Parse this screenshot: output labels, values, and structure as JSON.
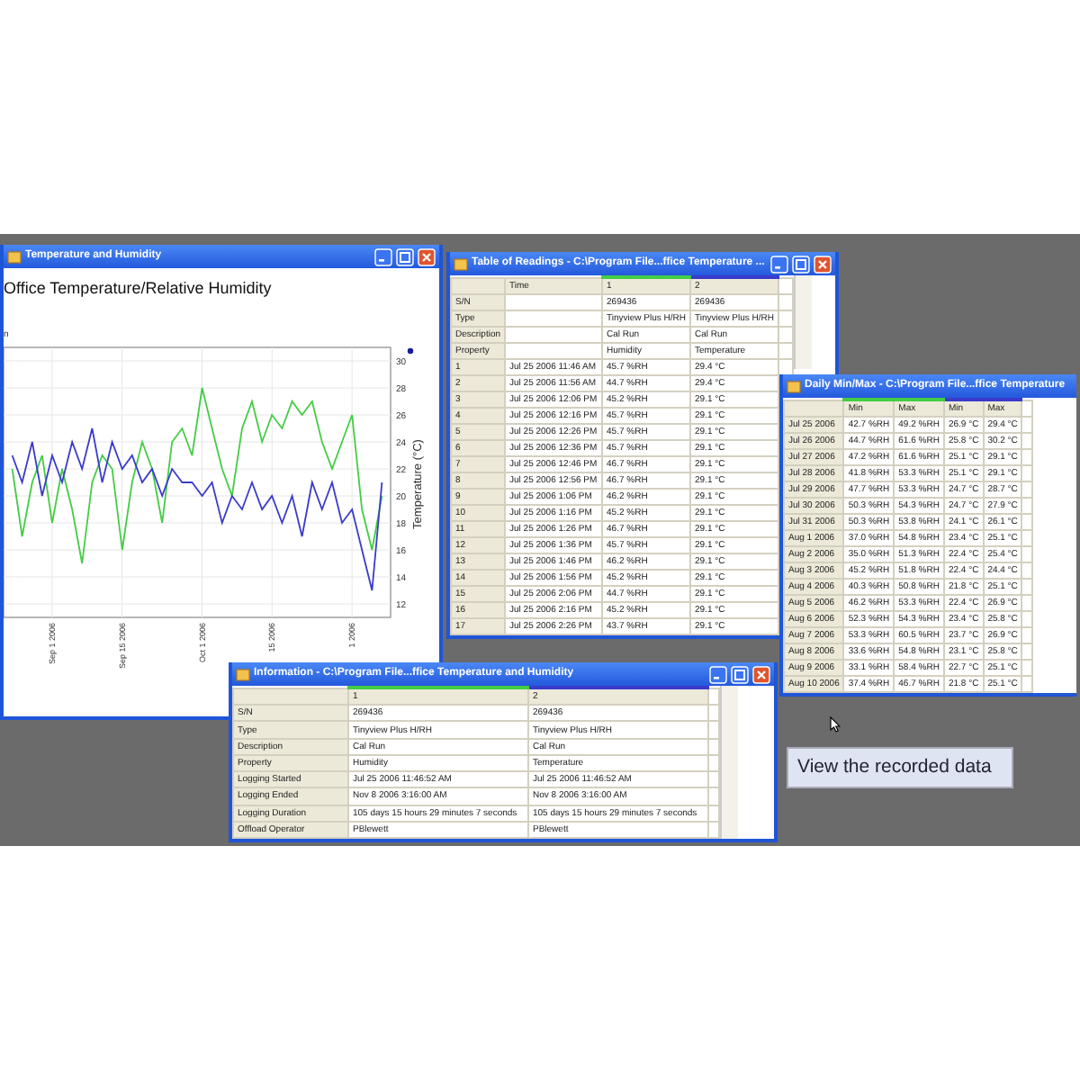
{
  "chart_window": {
    "title": "Temperature and Humidity",
    "legend_fragment": "n",
    "chart_data": {
      "type": "line",
      "title": "Office Temperature/Relative Humidity",
      "ylabel": "Temperature (°C)",
      "categories": [
        null,
        null,
        null,
        null,
        "Sep 1 2006",
        null,
        null,
        null,
        null,
        null,
        null,
        "Sep 15 2006",
        null,
        null,
        null,
        null,
        null,
        null,
        null,
        "Oct 1 2006",
        null,
        null,
        null,
        null,
        null,
        null,
        "15 2006",
        null,
        null,
        null,
        null,
        null,
        null,
        null,
        "1 2006",
        null,
        null,
        null
      ],
      "series": [
        {
          "color": "#44cc44",
          "values": [
            22,
            17,
            21,
            23,
            18,
            22,
            19,
            15,
            21,
            23,
            22,
            16,
            21,
            24,
            22,
            18,
            24,
            25,
            23,
            28,
            25,
            22,
            20,
            25,
            27,
            24,
            26,
            25,
            27,
            26,
            27,
            24,
            22,
            24,
            26,
            19,
            16,
            20
          ]
        },
        {
          "color": "#3a3acc",
          "values": [
            23,
            21,
            24,
            20,
            23,
            21,
            24,
            22,
            25,
            21,
            24,
            22,
            23,
            21,
            22,
            20,
            22,
            21,
            21,
            20,
            21,
            18,
            20,
            19,
            21,
            19,
            20,
            18,
            20,
            17,
            21,
            19,
            21,
            18,
            19,
            16,
            13,
            21
          ]
        }
      ],
      "ylim": [
        11,
        31
      ],
      "grid": true,
      "yticks": [
        30,
        28,
        26,
        24,
        22,
        20,
        18,
        16,
        14,
        12
      ]
    }
  },
  "readings_window": {
    "title": "Table of Readings - C:\\Program File...ffice Temperature ...",
    "columns": [
      {
        "label": "Time"
      },
      {
        "label": "1",
        "color": "#44cc44"
      },
      {
        "label": "2",
        "color": "#3a3acc"
      }
    ],
    "rows": [
      {
        "label": "S/N",
        "values": [
          "269436",
          "269436"
        ]
      },
      {
        "label": "Type",
        "values": [
          "Tinyview Plus H/RH",
          "Tinyview Plus H/RH"
        ]
      },
      {
        "label": "Description",
        "values": [
          "Cal Run",
          "Cal Run"
        ]
      },
      {
        "label": "Property",
        "values": [
          "Humidity",
          "Temperature"
        ]
      },
      {
        "label": "1",
        "time": "Jul 25 2006 11:46 AM",
        "values": [
          "45.7 %RH",
          "29.4 °C"
        ]
      },
      {
        "label": "2",
        "time": "Jul 25 2006 11:56 AM",
        "values": [
          "44.7 %RH",
          "29.4 °C"
        ]
      },
      {
        "label": "3",
        "time": "Jul 25 2006 12:06 PM",
        "values": [
          "45.2 %RH",
          "29.1 °C"
        ]
      },
      {
        "label": "4",
        "time": "Jul 25 2006 12:16 PM",
        "values": [
          "45.7 %RH",
          "29.1 °C"
        ]
      },
      {
        "label": "5",
        "time": "Jul 25 2006 12:26 PM",
        "values": [
          "45.7 %RH",
          "29.1 °C"
        ]
      },
      {
        "label": "6",
        "time": "Jul 25 2006 12:36 PM",
        "values": [
          "45.7 %RH",
          "29.1 °C"
        ]
      },
      {
        "label": "7",
        "time": "Jul 25 2006 12:46 PM",
        "values": [
          "46.7 %RH",
          "29.1 °C"
        ]
      },
      {
        "label": "8",
        "time": "Jul 25 2006 12:56 PM",
        "values": [
          "46.7 %RH",
          "29.1 °C"
        ]
      },
      {
        "label": "9",
        "time": "Jul 25 2006 1:06 PM",
        "values": [
          "46.2 %RH",
          "29.1 °C"
        ]
      },
      {
        "label": "10",
        "time": "Jul 25 2006 1:16 PM",
        "values": [
          "45.2 %RH",
          "29.1 °C"
        ]
      },
      {
        "label": "11",
        "time": "Jul 25 2006 1:26 PM",
        "values": [
          "46.7 %RH",
          "29.1 °C"
        ]
      },
      {
        "label": "12",
        "time": "Jul 25 2006 1:36 PM",
        "values": [
          "45.7 %RH",
          "29.1 °C"
        ]
      },
      {
        "label": "13",
        "time": "Jul 25 2006 1:46 PM",
        "values": [
          "46.2 %RH",
          "29.1 °C"
        ]
      },
      {
        "label": "14",
        "time": "Jul 25 2006 1:56 PM",
        "values": [
          "45.2 %RH",
          "29.1 °C"
        ]
      },
      {
        "label": "15",
        "time": "Jul 25 2006 2:06 PM",
        "values": [
          "44.7 %RH",
          "29.1 °C"
        ]
      },
      {
        "label": "16",
        "time": "Jul 25 2006 2:16 PM",
        "values": [
          "45.2 %RH",
          "29.1 °C"
        ]
      },
      {
        "label": "17",
        "time": "Jul 25 2006 2:26 PM",
        "values": [
          "43.7 %RH",
          "29.1 °C"
        ]
      }
    ]
  },
  "minmax_window": {
    "title": "Daily Min/Max - C:\\Program File...ffice Temperature",
    "columns": [
      {
        "label": "Min",
        "color": "#44cc44"
      },
      {
        "label": "Max",
        "color": "#44cc44"
      },
      {
        "label": "Min",
        "color": "#3a3acc"
      },
      {
        "label": "Max",
        "color": "#3a3acc"
      }
    ],
    "rows": [
      {
        "date": "Jul 25 2006",
        "values": [
          "42.7 %RH",
          "49.2 %RH",
          "26.9 °C",
          "29.4 °C"
        ]
      },
      {
        "date": "Jul 26 2006",
        "values": [
          "44.7 %RH",
          "61.6 %RH",
          "25.8 °C",
          "30.2 °C"
        ]
      },
      {
        "date": "Jul 27 2006",
        "values": [
          "47.2 %RH",
          "61.6 %RH",
          "25.1 °C",
          "29.1 °C"
        ]
      },
      {
        "date": "Jul 28 2006",
        "values": [
          "41.8 %RH",
          "53.3 %RH",
          "25.1 °C",
          "29.1 °C"
        ]
      },
      {
        "date": "Jul 29 2006",
        "values": [
          "47.7 %RH",
          "53.3 %RH",
          "24.7 °C",
          "28.7 °C"
        ]
      },
      {
        "date": "Jul 30 2006",
        "values": [
          "50.3 %RH",
          "54.3 %RH",
          "24.7 °C",
          "27.9 °C"
        ]
      },
      {
        "date": "Jul 31 2006",
        "values": [
          "50.3 %RH",
          "53.8 %RH",
          "24.1 °C",
          "26.1 °C"
        ]
      },
      {
        "date": "Aug 1 2006",
        "values": [
          "37.0 %RH",
          "54.8 %RH",
          "23.4 °C",
          "25.1 °C"
        ]
      },
      {
        "date": "Aug 2 2006",
        "values": [
          "35.0 %RH",
          "51.3 %RH",
          "22.4 °C",
          "25.4 °C"
        ]
      },
      {
        "date": "Aug 3 2006",
        "values": [
          "45.2 %RH",
          "51.8 %RH",
          "22.4 °C",
          "24.4 °C"
        ]
      },
      {
        "date": "Aug 4 2006",
        "values": [
          "40.3 %RH",
          "50.8 %RH",
          "21.8 °C",
          "25.1 °C"
        ]
      },
      {
        "date": "Aug 5 2006",
        "values": [
          "46.2 %RH",
          "53.3 %RH",
          "22.4 °C",
          "26.9 °C"
        ]
      },
      {
        "date": "Aug 6 2006",
        "values": [
          "52.3 %RH",
          "54.3 %RH",
          "23.4 °C",
          "25.8 °C"
        ]
      },
      {
        "date": "Aug 7 2006",
        "values": [
          "53.3 %RH",
          "60.5 %RH",
          "23.7 °C",
          "26.9 °C"
        ]
      },
      {
        "date": "Aug 8 2006",
        "values": [
          "33.6 %RH",
          "54.8 %RH",
          "23.1 °C",
          "25.8 °C"
        ]
      },
      {
        "date": "Aug 9 2006",
        "values": [
          "33.1 %RH",
          "58.4 %RH",
          "22.7 °C",
          "25.1 °C"
        ]
      },
      {
        "date": "Aug 10 2006",
        "values": [
          "37.4 %RH",
          "46.7 %RH",
          "21.8 °C",
          "25.1 °C"
        ]
      }
    ]
  },
  "info_window": {
    "title": "Information - C:\\Program File...ffice Temperature and Humidity",
    "columns": [
      {
        "label": "1",
        "color": "#44cc44"
      },
      {
        "label": "2",
        "color": "#3a3acc"
      }
    ],
    "rows": [
      {
        "label": "S/N",
        "values": [
          "269436",
          "269436"
        ]
      },
      {
        "label": "Type",
        "values": [
          "Tinyview Plus H/RH",
          "Tinyview Plus H/RH"
        ]
      },
      {
        "label": "Description",
        "values": [
          "Cal Run",
          "Cal Run"
        ]
      },
      {
        "label": "Property",
        "values": [
          "Humidity",
          "Temperature"
        ]
      },
      {
        "label": "Logging Started",
        "values": [
          "Jul 25 2006 11:46:52 AM",
          "Jul 25 2006 11:46:52 AM"
        ]
      },
      {
        "label": "Logging Ended",
        "values": [
          "Nov 8 2006 3:16:00 AM",
          "Nov 8 2006 3:16:00 AM"
        ]
      },
      {
        "label": "Logging Duration",
        "values": [
          "105 days 15 hours 29 minutes 7 seconds",
          "105 days 15 hours 29 minutes 7 seconds"
        ]
      },
      {
        "label": "Offload Operator",
        "values": [
          "PBlewett",
          "PBlewett"
        ]
      }
    ]
  },
  "caption": "View the recorded data"
}
